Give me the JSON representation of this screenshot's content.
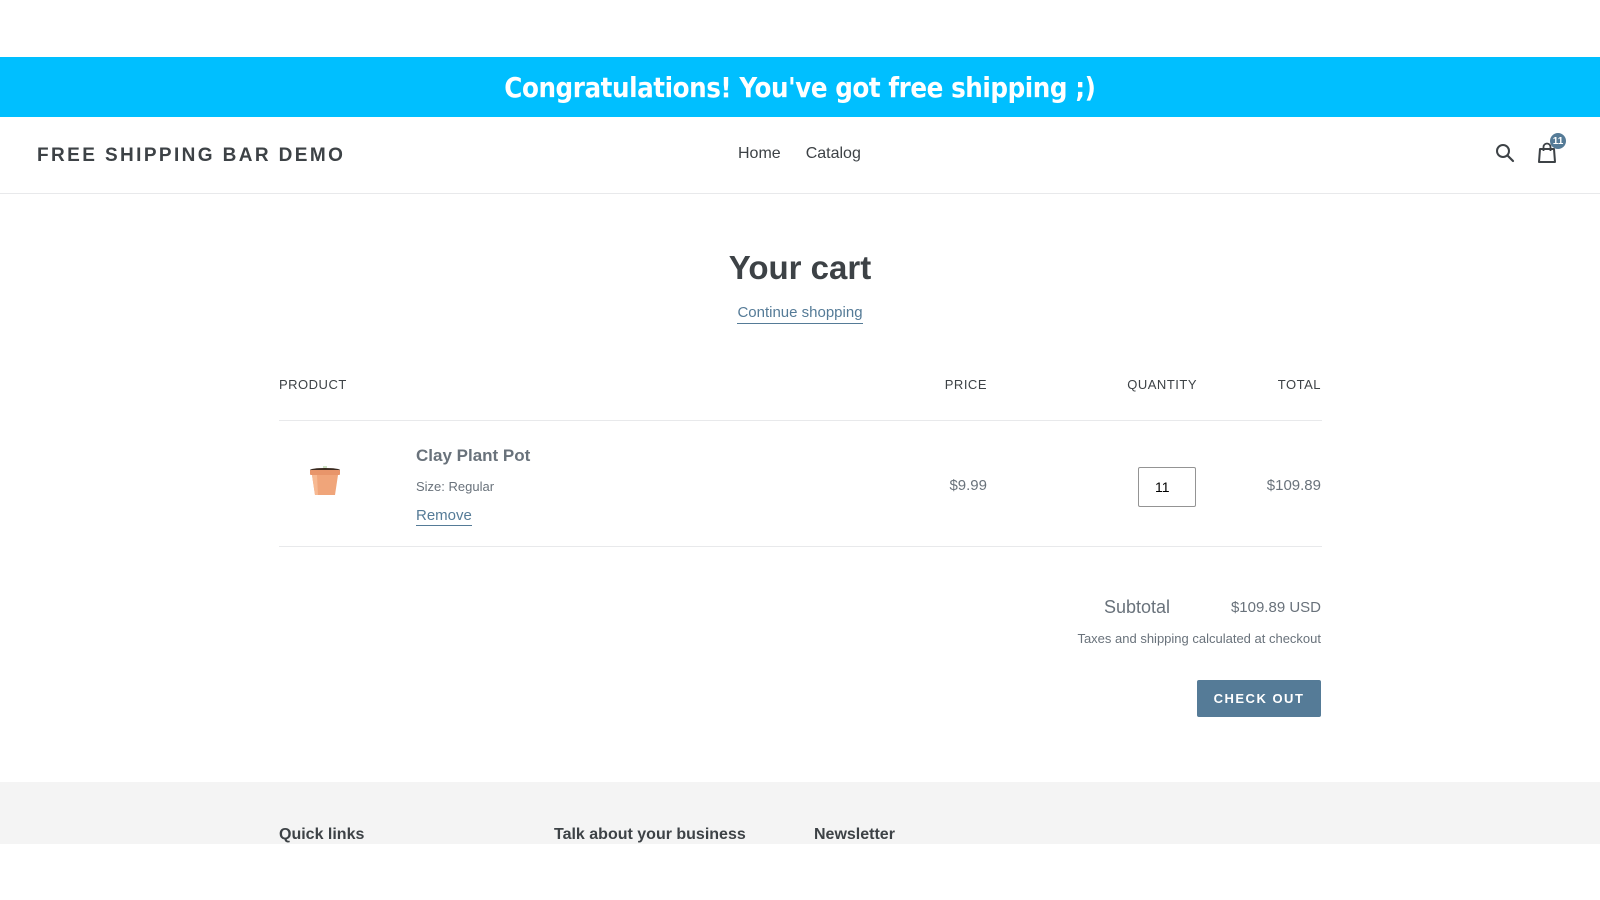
{
  "announcement": {
    "text": "Congratulations! You've got free shipping ;)",
    "background": "#00bfff"
  },
  "header": {
    "logo": "FREE SHIPPING BAR DEMO",
    "nav": [
      {
        "label": "Home"
      },
      {
        "label": "Catalog"
      }
    ],
    "icons": {
      "search": "search-icon",
      "cart": "shopping-bag-icon"
    },
    "cart_count": "11"
  },
  "cart": {
    "title": "Your cart",
    "continue_label": "Continue shopping",
    "columns": {
      "product": "PRODUCT",
      "price": "PRICE",
      "quantity": "QUANTITY",
      "total": "TOTAL"
    },
    "items": [
      {
        "name": "Clay Plant Pot",
        "variant": "Size: Regular",
        "remove_label": "Remove",
        "price": "$9.99",
        "quantity": "11",
        "total": "$109.89"
      }
    ],
    "subtotal_label": "Subtotal",
    "subtotal_value": "$109.89 USD",
    "tax_note": "Taxes and shipping calculated at checkout",
    "checkout_label": "CHECK OUT",
    "accent": "#557b97"
  },
  "footer": {
    "headings": [
      "Quick links",
      "Talk about your business",
      "Newsletter"
    ]
  }
}
